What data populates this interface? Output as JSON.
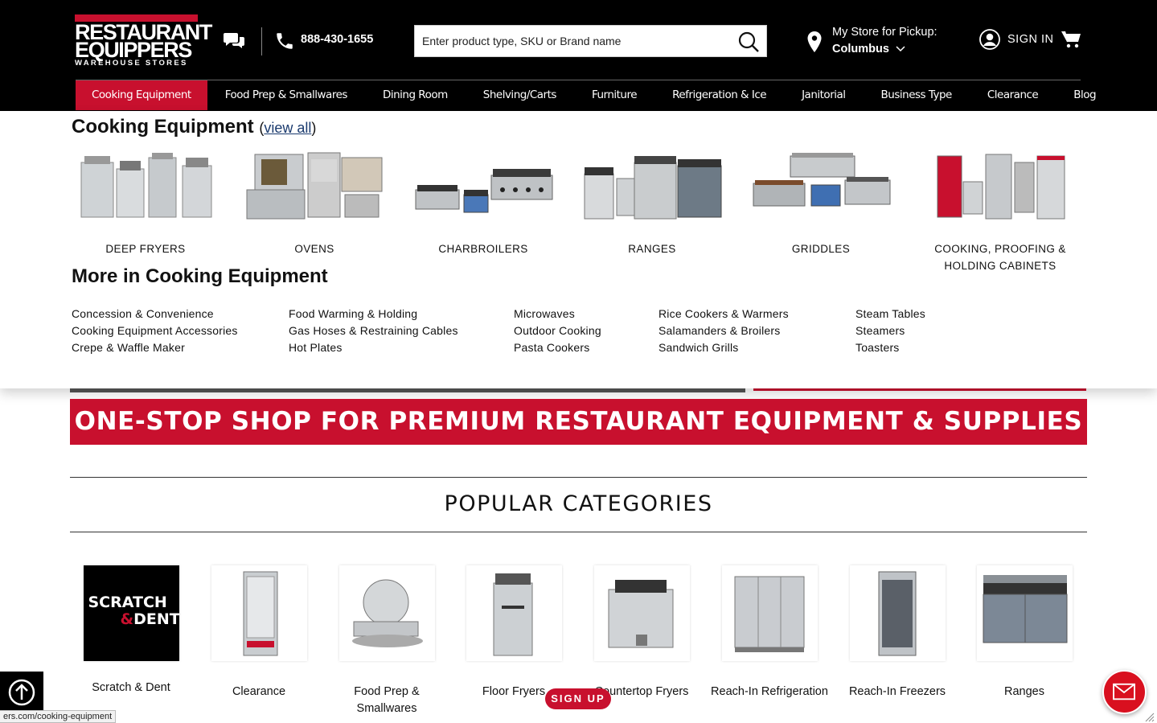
{
  "logo": {
    "line1": "RESTAURANT",
    "line2": "EQUIPPERS",
    "line3": "WAREHOUSE STORES"
  },
  "header": {
    "phone": "888-430-1655",
    "search_placeholder": "Enter product type, SKU or Brand name",
    "store_label": "My Store for Pickup:",
    "store_city": "Columbus",
    "signin_label": "SIGN IN"
  },
  "nav": {
    "items": [
      "Cooking Equipment",
      "Food Prep & Smallwares",
      "Dining Room",
      "Shelving/Carts",
      "Furniture",
      "Refrigeration & Ice",
      "Janitorial",
      "Business Type",
      "Clearance",
      "Blog"
    ],
    "active": "Cooking Equipment"
  },
  "mega": {
    "title": "Cooking Equipment",
    "view_all": "view all",
    "categories": [
      {
        "label": "DEEP FRYERS",
        "icon": "deep-fryers-image"
      },
      {
        "label": "OVENS",
        "icon": "ovens-image"
      },
      {
        "label": "CHARBROILERS",
        "icon": "charbroilers-image"
      },
      {
        "label": "RANGES",
        "icon": "ranges-image"
      },
      {
        "label": "GRIDDLES",
        "icon": "griddles-image"
      },
      {
        "label": "COOKING, PROOFING & HOLDING CABINETS",
        "icon": "cabinets-image"
      }
    ],
    "more_title": "More in Cooking Equipment",
    "more_columns": [
      [
        "Concession & Convenience",
        "Cooking Equipment Accessories",
        "Crepe & Waffle Maker"
      ],
      [
        "Food Warming & Holding",
        "Gas Hoses & Restraining Cables",
        "Hot Plates"
      ],
      [
        "Microwaves",
        "Outdoor Cooking",
        "Pasta Cookers"
      ],
      [
        "Rice Cookers & Warmers",
        "Salamanders & Broilers",
        "Sandwich Grills"
      ],
      [
        "Steam Tables",
        "Steamers",
        "Toasters"
      ]
    ]
  },
  "banner": "ONE-STOP SHOP FOR PREMIUM RESTAURANT EQUIPMENT & SUPPLIES",
  "popular": {
    "title": "POPULAR CATEGORIES",
    "items": [
      {
        "label": "Scratch & Dent",
        "img_line1": "SCRATCH",
        "img_amp": "&",
        "img_line2": "DENT"
      },
      {
        "label": "Clearance"
      },
      {
        "label": "Food Prep & Smallwares"
      },
      {
        "label": "Floor Fryers"
      },
      {
        "label": "Countertop Fryers"
      },
      {
        "label": "Reach-In Refrigeration"
      },
      {
        "label": "Reach-In Freezers"
      },
      {
        "label": "Ranges"
      }
    ]
  },
  "signup_label": "SIGN UP",
  "status_url": "ers.com/cooking-equipment",
  "colors": {
    "brand_red": "#c8102e",
    "header_bg": "#000000"
  }
}
